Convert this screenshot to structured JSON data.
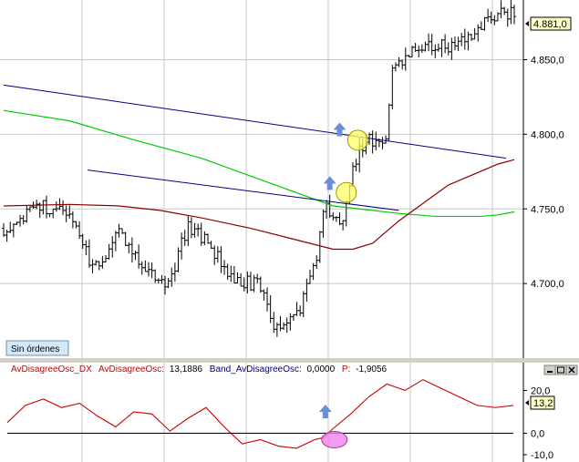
{
  "chart_data": [
    {
      "type": "ohlc",
      "panel": "price",
      "y_ticks": [
        "4.700,0",
        "4.750,0",
        "4.800,0",
        "4.850,0"
      ],
      "y_tick_values": [
        4700,
        4750,
        4800,
        4850
      ],
      "last_price_label": "4.881,0",
      "ylim": [
        4650,
        4890
      ],
      "grid": true,
      "price_seed": 4736,
      "series_points": [
        {
          "name": "",
          "color": "#00cc00",
          "x": [
            0,
            40,
            80,
            120,
            160,
            200,
            240,
            262,
            290,
            300,
            310
          ],
          "y": [
            4816,
            4809,
            4796,
            4784,
            4768,
            4752,
            4747,
            4745,
            4745,
            4746,
            4748
          ]
        },
        {
          "name": "",
          "color": "#8b0000",
          "x": [
            0,
            40,
            70,
            95,
            120,
            150,
            175,
            200,
            212,
            224,
            240,
            270,
            300,
            310
          ],
          "y": [
            4752,
            4753,
            4752,
            4749,
            4744,
            4737,
            4730,
            4723,
            4723,
            4727,
            4742,
            4766,
            4780,
            4783
          ]
        }
      ],
      "trend_lines": [
        {
          "color": "#000080",
          "x": [
            0,
            305
          ],
          "y": [
            4833,
            4784
          ]
        },
        {
          "color": "#000080",
          "x": [
            51,
            240
          ],
          "y": [
            4776,
            4749
          ]
        }
      ],
      "markers": [
        {
          "type": "arrow-up",
          "x": 204,
          "y": 4803,
          "color": "#6a8fd8"
        },
        {
          "type": "arrow-up",
          "x": 198,
          "y": 4767,
          "color": "#6a8fd8"
        },
        {
          "type": "circle",
          "x": 215,
          "y": 4796,
          "color": "#ffff66"
        },
        {
          "type": "circle",
          "x": 208,
          "y": 4761,
          "color": "#ffff66"
        }
      ],
      "button_label": "Sin órdenes"
    },
    {
      "type": "line",
      "panel": "oscillator",
      "legend": {
        "name1": "AvDisagreeOsc_DX",
        "name2": "AvDisagreeOsc:",
        "value2": "13,1886",
        "name3": "Band_AvDisagreeOsc:",
        "value3": "0,0000",
        "name4": "P:",
        "value4": "-1,9056"
      },
      "y_ticks": [
        "20,0",
        "0,0",
        "-10,0"
      ],
      "y_tick_values": [
        20,
        0,
        -10
      ],
      "last_value_label": "13,2",
      "ylim": [
        -13,
        27
      ],
      "series": [
        {
          "name": "",
          "color": "#cc0000",
          "x": [
            0,
            10,
            20,
            30,
            40,
            50,
            60,
            70,
            80,
            90,
            100,
            110,
            120,
            130,
            140,
            150,
            160,
            170,
            175,
            180,
            190,
            200,
            210,
            220,
            230,
            240,
            250,
            260,
            270,
            280
          ],
          "y": [
            5,
            13,
            16,
            12,
            14,
            8,
            3,
            10,
            9,
            1,
            7,
            12,
            3,
            -5,
            -3,
            -6,
            -7,
            -3,
            -2,
            2,
            9,
            17,
            23,
            20,
            25,
            21,
            17,
            13,
            12,
            13
          ]
        },
        {
          "name": "",
          "color": "#00008b",
          "x": [
            0,
            280
          ],
          "y": [
            0,
            0
          ]
        }
      ],
      "markers": [
        {
          "type": "arrow-up",
          "x": 176,
          "y": 10,
          "color": "#6a8fd8"
        },
        {
          "type": "ellipse",
          "x": 181,
          "y": -3,
          "color": "#ee82ee"
        }
      ]
    }
  ]
}
